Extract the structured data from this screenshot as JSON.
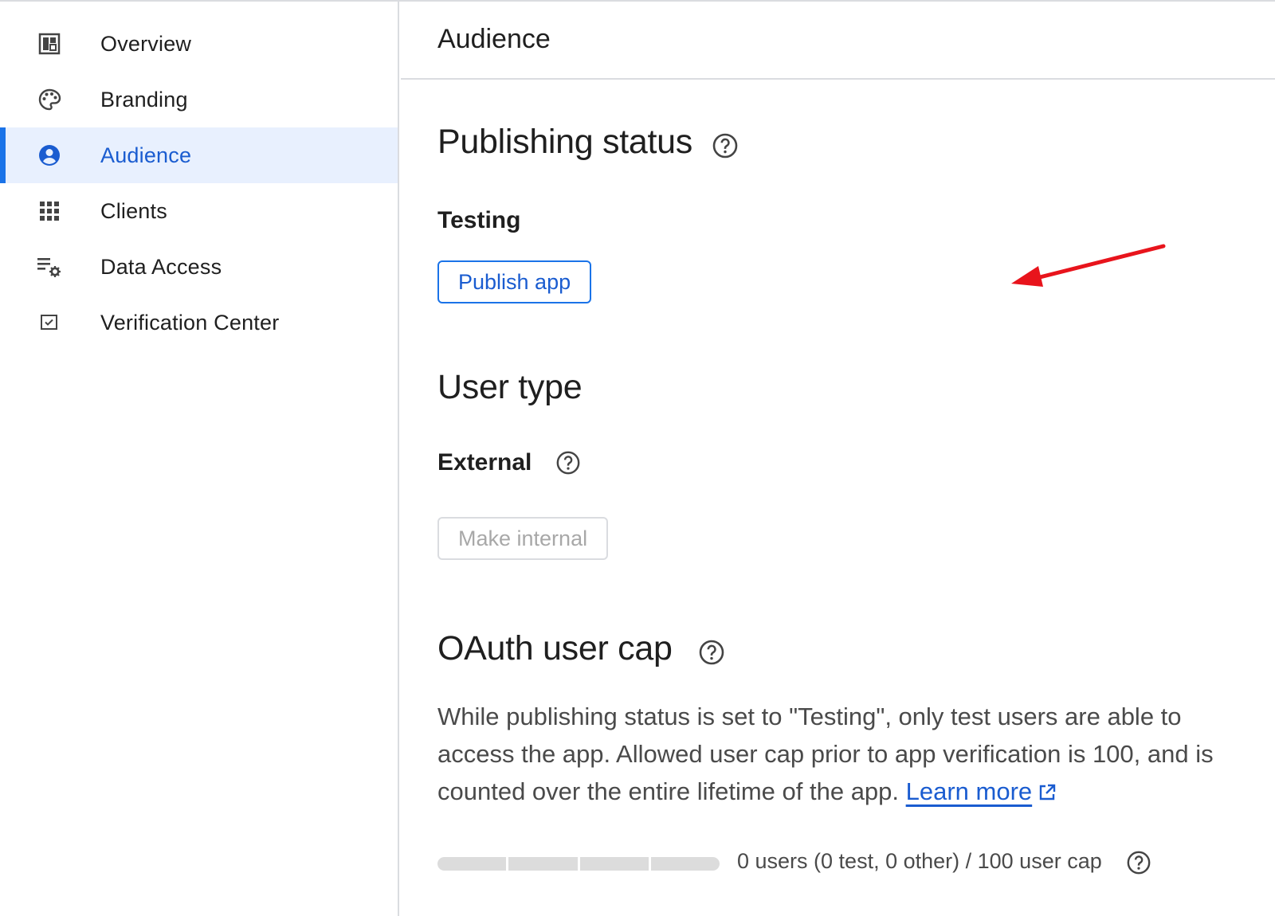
{
  "sidebar": {
    "items": [
      {
        "label": "Overview",
        "icon": "dashboard-icon",
        "active": false
      },
      {
        "label": "Branding",
        "icon": "palette-icon",
        "active": false
      },
      {
        "label": "Audience",
        "icon": "account-circle-icon",
        "active": true
      },
      {
        "label": "Clients",
        "icon": "apps-grid-icon",
        "active": false
      },
      {
        "label": "Data Access",
        "icon": "list-settings-icon",
        "active": false
      },
      {
        "label": "Verification Center",
        "icon": "checkbox-icon",
        "active": false
      }
    ]
  },
  "header": {
    "title": "Audience"
  },
  "publishing": {
    "heading": "Publishing status",
    "status": "Testing",
    "publish_button": "Publish app"
  },
  "user_type": {
    "heading": "User type",
    "value": "External",
    "make_internal_button": "Make internal"
  },
  "oauth_cap": {
    "heading": "OAuth user cap",
    "description": "While publishing status is set to \"Testing\", only test users are able to access the app. Allowed user cap prior to app verification is 100, and is counted over the entire lifetime of the app. ",
    "learn_more": "Learn more",
    "usage_text": "0 users (0 test, 0 other) / 100 user cap",
    "usage_fraction": 0
  },
  "colors": {
    "accent": "#1a73e8",
    "active_bg": "#e8f0fe",
    "annotation_arrow": "#e8141c"
  }
}
